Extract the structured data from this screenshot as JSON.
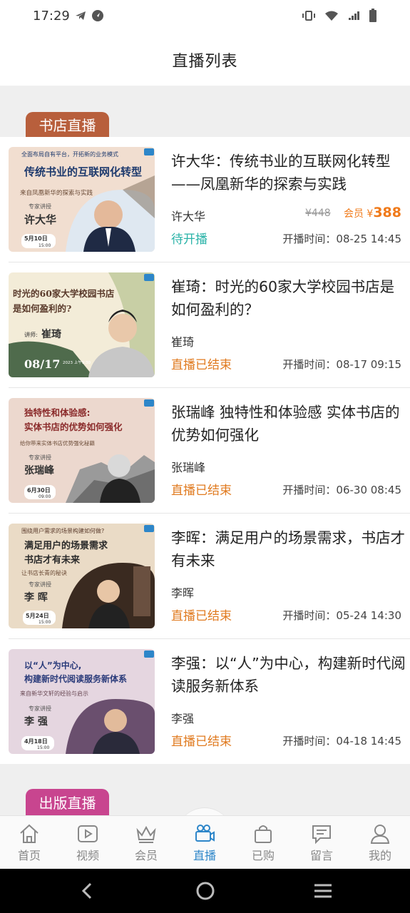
{
  "status_bar": {
    "time": "17:29"
  },
  "header": {
    "title": "直播列表"
  },
  "sections": [
    {
      "label": "书店直播"
    },
    {
      "label": "出版直播"
    }
  ],
  "cards": [
    {
      "title": "许大华：传统书业的互联网化转型——凤凰新华的探索与实践",
      "author": "许大华",
      "status": "待开播",
      "time": "开播时间：08-25 14:45",
      "orig_price": "¥448",
      "member_label": "会员 ¥",
      "member_price": "388",
      "thumb": {
        "headline": "传统书业的互联网化转型",
        "top": "全面布局自有平台，开拓新的业务模式",
        "sub": "来自凤凰新华的探索与实践",
        "tag": "专家讲授",
        "name": "许大华",
        "date": "5月10日",
        "hour": "15:00"
      }
    },
    {
      "title": "崔琦：时光的60家大学校园书店是如何盈利的？",
      "author": "崔琦",
      "status": "直播已结束",
      "time": "开播时间：08-17 09:15",
      "thumb": {
        "headline": "时光的60家大学校园书店",
        "sub": "是如何盈利的?",
        "tag": "讲师:",
        "name": "崔琦",
        "date": "08/17",
        "hour": "2023 上午9:30"
      }
    },
    {
      "title": "张瑞峰 独特性和体验感 实体书店的优势如何强化",
      "author": "张瑞峰",
      "status": "直播已结束",
      "time": "开播时间：06-30 08:45",
      "thumb": {
        "headline": "独特性和体验感:",
        "headline2": "实体书店的优势如何强化",
        "sub": "给你带来实体书店优势强化秘籍",
        "tag": "专家讲授",
        "name": "张瑞峰",
        "date": "6月30日",
        "hour": "09:00"
      }
    },
    {
      "title": "李晖：满足用户的场景需求，书店才有未来",
      "author": "李晖",
      "status": "直播已结束",
      "time": "开播时间：05-24 14:30",
      "thumb": {
        "top": "围绕用户需求的场景构建如何做?",
        "headline": "满足用户的场景需求",
        "headline2": "书店才有未来",
        "sub": "让书店长青的秘诀",
        "tag": "专家讲授",
        "name": "李 晖",
        "date": "5月24日",
        "hour": "15:00"
      }
    },
    {
      "title": "李强：以“人”为中心，构建新时代阅读服务新体系",
      "author": "李强",
      "status": "直播已结束",
      "time": "开播时间：04-18 14:45",
      "thumb": {
        "headline": "以“人”为中心,",
        "headline2": "构建新时代阅读服务新体系",
        "sub": "来自新华文轩的经验与启示",
        "tag": "专家讲授",
        "name": "李 强",
        "date": "4月18日",
        "hour": "15:00"
      }
    }
  ],
  "tabbar": [
    {
      "label": "首页",
      "icon": "home-icon"
    },
    {
      "label": "视频",
      "icon": "video-icon"
    },
    {
      "label": "会员",
      "icon": "crown-icon"
    },
    {
      "label": "直播",
      "icon": "live-camera-icon",
      "active": true
    },
    {
      "label": "已购",
      "icon": "bag-icon"
    },
    {
      "label": "留言",
      "icon": "message-icon"
    },
    {
      "label": "我的",
      "icon": "user-icon"
    }
  ],
  "colors": {
    "accent": "#2d86c9",
    "upcoming": "#2ab3a8",
    "ended": "#e07a1f",
    "bookstore_tab": "#b85f3c",
    "publishing_tab": "#c8458f"
  }
}
